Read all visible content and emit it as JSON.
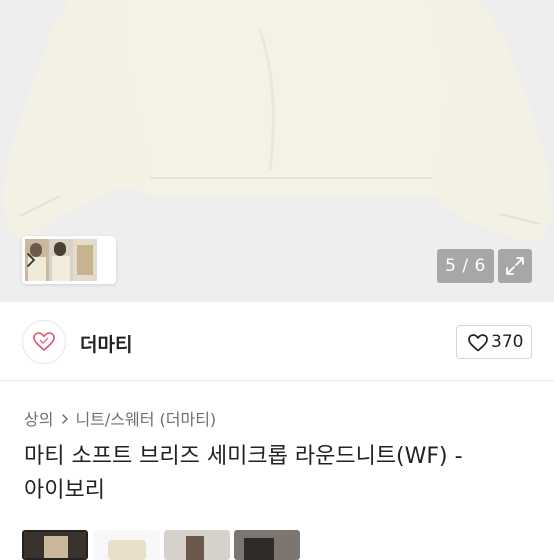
{
  "gallery": {
    "counter_current": "5",
    "counter_total": "6",
    "counter_text": "5 / 6",
    "expand_icon": "expand-arrows-icon",
    "thumbs_next_icon": "chevron-right-icon"
  },
  "shop": {
    "name": "더마티",
    "logo_icon": "heart-logo-icon",
    "like_count": "370",
    "like_icon": "heart-outline-icon"
  },
  "breadcrumb": {
    "category": "상의",
    "subcategory": "니트/스웨터 (더마티)",
    "separator_icon": "chevron-right-icon"
  },
  "product": {
    "title": "마티 소프트 브리즈 세미크롭 라운드니트(WF) - 아이보리"
  },
  "colors": {
    "hero_bg": "#ededed",
    "garment": "#f4f1e6",
    "overlay": "#8c8c8c",
    "logo_accent": "#e0566e"
  }
}
